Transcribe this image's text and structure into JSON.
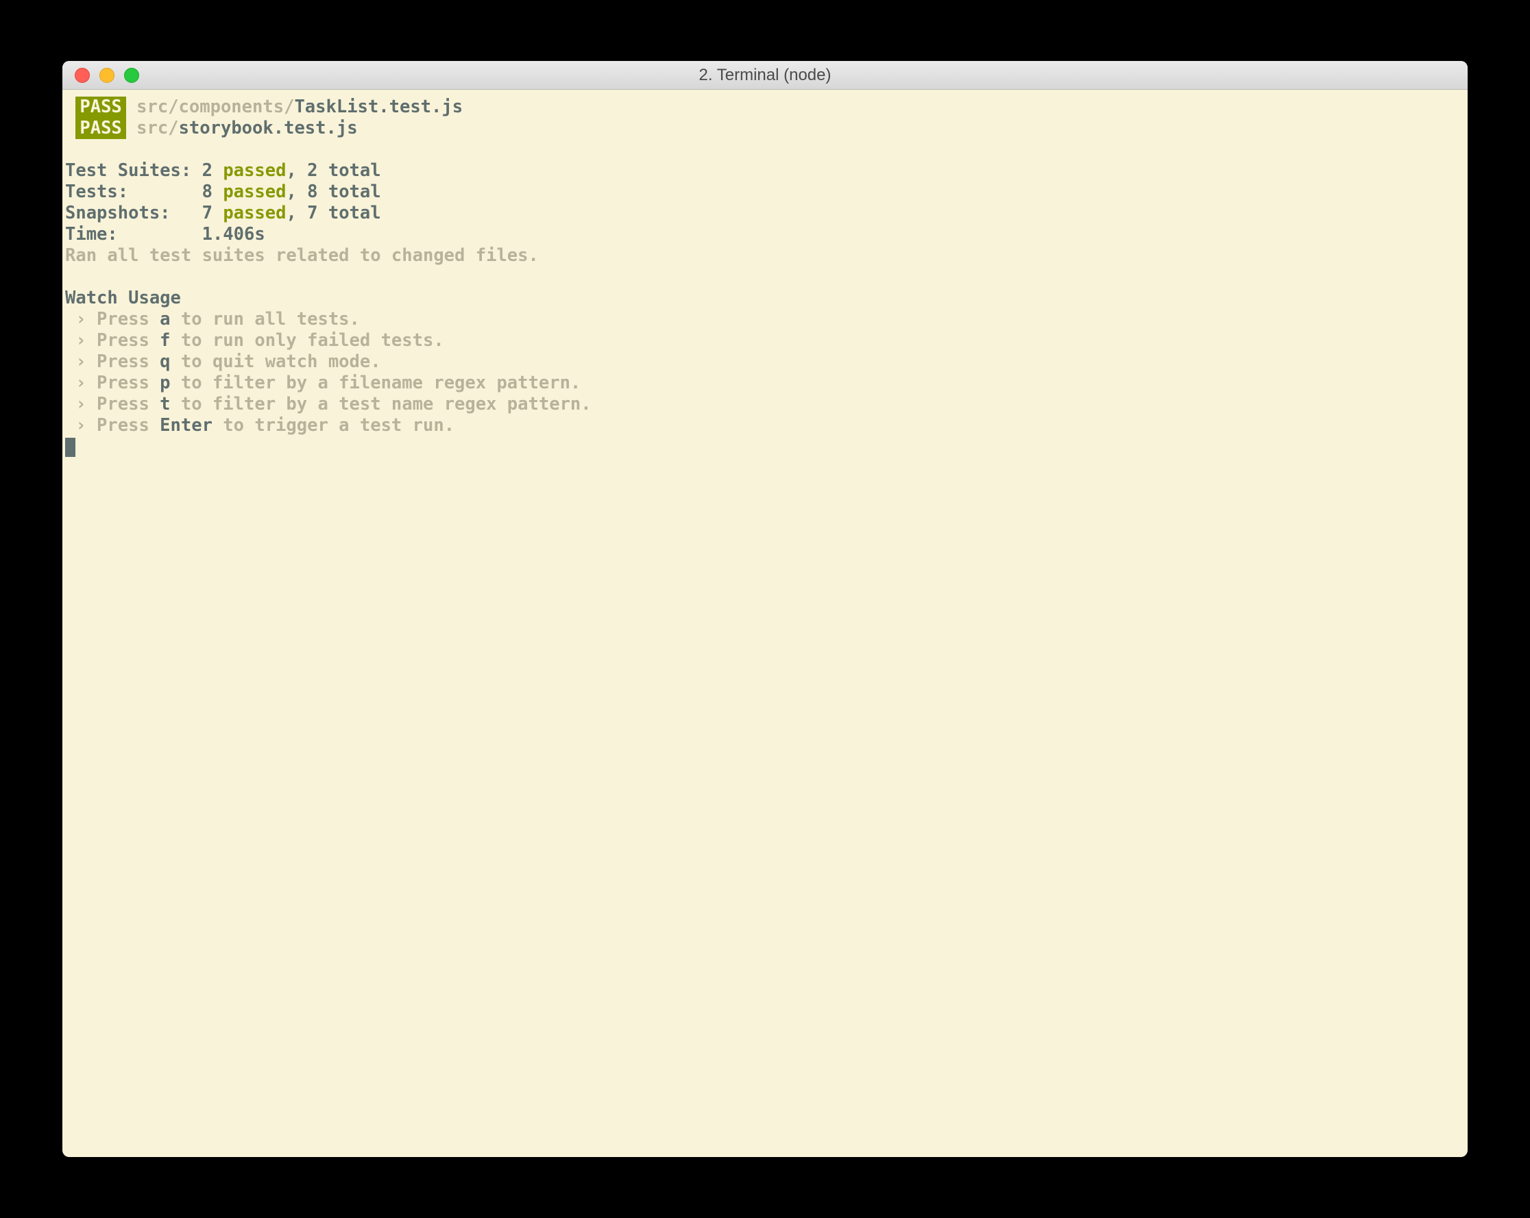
{
  "window": {
    "title": "2. Terminal (node)"
  },
  "passFiles": [
    {
      "badge": "PASS",
      "dir": "src/components/",
      "file": "TaskList.test.js"
    },
    {
      "badge": "PASS",
      "dir": "src/",
      "file": "storybook.test.js"
    }
  ],
  "summary": {
    "suites": {
      "label": "Test Suites: ",
      "count": "2 ",
      "passed": "passed",
      "rest": ", 2 total"
    },
    "tests": {
      "label": "Tests:       ",
      "count": "8 ",
      "passed": "passed",
      "rest": ", 8 total"
    },
    "snaps": {
      "label": "Snapshots:   ",
      "count": "7 ",
      "passed": "passed",
      "rest": ", 7 total"
    },
    "time": {
      "label": "Time:        ",
      "value": "1.406s"
    }
  },
  "ranLine": "Ran all test suites related to changed files.",
  "watch": {
    "header": "Watch Usage",
    "items": [
      {
        "prefix": " › Press ",
        "key": "a",
        "rest": " to run all tests."
      },
      {
        "prefix": " › Press ",
        "key": "f",
        "rest": " to run only failed tests."
      },
      {
        "prefix": " › Press ",
        "key": "q",
        "rest": " to quit watch mode."
      },
      {
        "prefix": " › Press ",
        "key": "p",
        "rest": " to filter by a filename regex pattern."
      },
      {
        "prefix": " › Press ",
        "key": "t",
        "rest": " to filter by a test name regex pattern."
      },
      {
        "prefix": " › Press ",
        "key": "Enter",
        "rest": " to trigger a test run."
      }
    ]
  }
}
